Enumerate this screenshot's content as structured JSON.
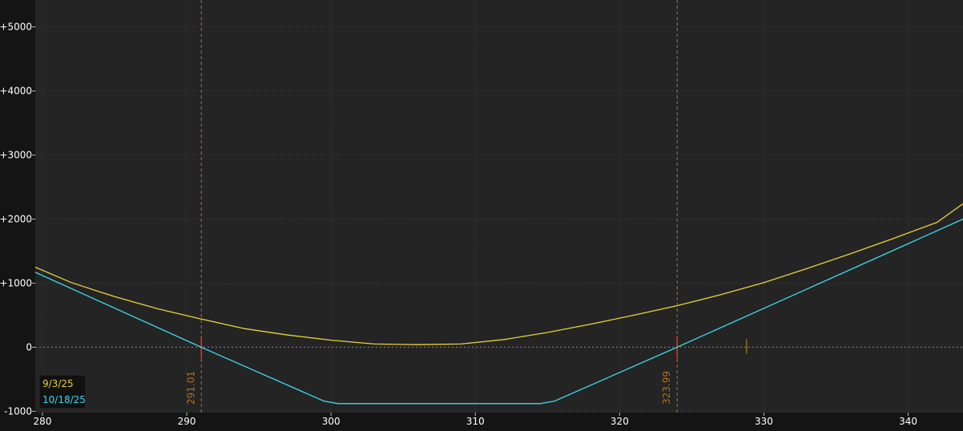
{
  "chart_data": {
    "type": "line",
    "title": "",
    "xlabel": "",
    "ylabel": "",
    "xlim": [
      279.5,
      343.8
    ],
    "ylim": [
      -1020,
      5420
    ],
    "grid": true,
    "x_ticks": [
      {
        "value": 280,
        "label": "280"
      },
      {
        "value": 290,
        "label": "290"
      },
      {
        "value": 300,
        "label": "300"
      },
      {
        "value": 310,
        "label": "310"
      },
      {
        "value": 320,
        "label": "320"
      },
      {
        "value": 330,
        "label": "330"
      },
      {
        "value": 340,
        "label": "340"
      }
    ],
    "y_ticks": [
      {
        "value": 5000,
        "label": "+5000"
      },
      {
        "value": 4000,
        "label": "+4000"
      },
      {
        "value": 3000,
        "label": "+3000"
      },
      {
        "value": 2000,
        "label": "+2000"
      },
      {
        "value": 1000,
        "label": "+1000"
      },
      {
        "value": 0,
        "label": "0"
      },
      {
        "value": -1000,
        "label": "-1000"
      }
    ],
    "series": [
      {
        "name": "9/3/25",
        "color": "#e8d23a",
        "x": [
          279.5,
          282,
          285,
          288,
          291,
          294,
          297,
          300,
          303,
          306,
          309,
          312,
          315,
          318,
          321,
          324,
          327,
          330,
          333,
          336,
          339,
          342,
          343.8
        ],
        "y": [
          1250,
          1010,
          790,
          600,
          440,
          290,
          190,
          110,
          50,
          40,
          50,
          120,
          230,
          360,
          500,
          650,
          820,
          1010,
          1230,
          1460,
          1700,
          1950,
          2240
        ]
      },
      {
        "name": "10/18/25",
        "color": "#3fd8e8",
        "x": [
          279.5,
          291,
          299.5,
          300.5,
          314.5,
          315.5,
          323.99,
          343.8
        ],
        "y": [
          1170,
          0,
          -840,
          -880,
          -880,
          -840,
          0,
          2000
        ]
      }
    ],
    "breakevens": [
      {
        "value": 291.01,
        "label": "291.01"
      },
      {
        "value": 323.99,
        "label": "323.99"
      }
    ],
    "current_price": 328.8,
    "legend_position": "bottom-left"
  },
  "colors": {
    "background": "#141414",
    "plot_background": "#242424",
    "grid": "#3a3a3a",
    "zero_line": "#8a8a8a",
    "breakeven_line": "#b5701c",
    "breakeven_tick": "#ff2a1a",
    "axis_text": "#ffffff",
    "price_marker": "#a08a20"
  }
}
